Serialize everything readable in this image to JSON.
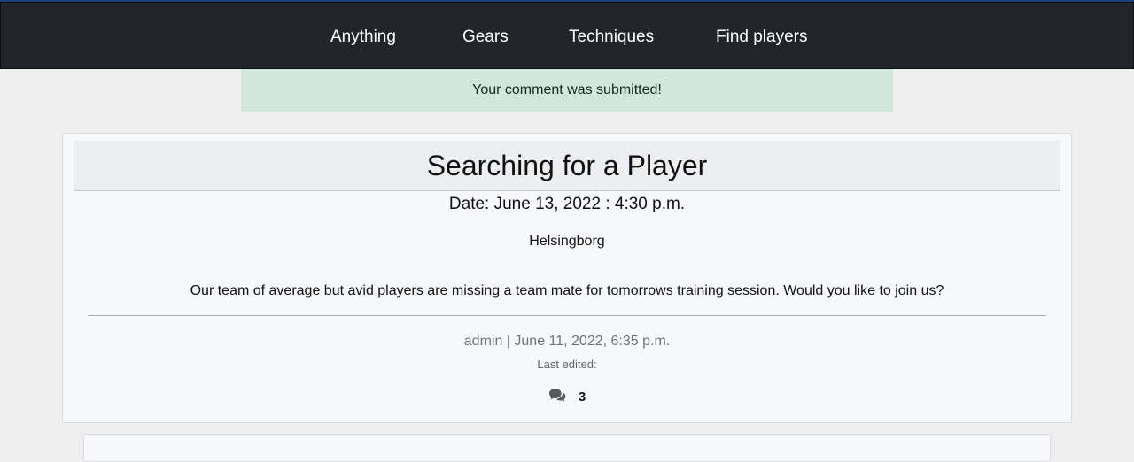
{
  "nav": {
    "items": [
      {
        "label": "Anything"
      },
      {
        "label": "Gears"
      },
      {
        "label": "Techniques"
      },
      {
        "label": "Find players"
      }
    ]
  },
  "alert": {
    "message": "Your comment was submitted!"
  },
  "post": {
    "title": "Searching for a Player",
    "date": "Date: June 13, 2022 : 4:30 p.m.",
    "location": "Helsingborg",
    "content": "Our team of average but avid players are missing a team mate for tomorrows training session. Would you like to join us?",
    "meta": "admin | June 11, 2022, 6:35 p.m.",
    "last_edited": "Last edited:",
    "comment_count": "3",
    "comment_icon": "comments-icon"
  },
  "colors": {
    "navbar_bg": "#212529",
    "alert_bg": "#d1e7dd",
    "page_bg": "#efefef",
    "card_bg": "#f7f8fa"
  }
}
